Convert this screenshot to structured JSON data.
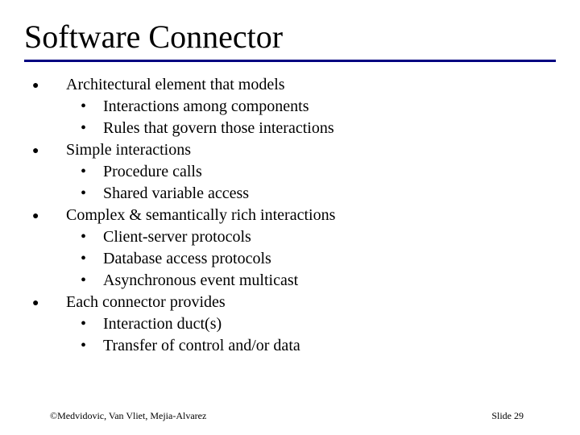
{
  "title": "Software Connector",
  "bullets": [
    {
      "text": "Architectural element that models",
      "sub": [
        "Interactions among components",
        "Rules that govern those interactions"
      ]
    },
    {
      "text": "Simple interactions",
      "sub": [
        "Procedure calls",
        "Shared variable access"
      ]
    },
    {
      "text": "Complex & semantically rich interactions",
      "sub": [
        "Client-server protocols",
        "Database access protocols",
        "Asynchronous event multicast"
      ]
    },
    {
      "text": "Each connector provides",
      "sub": [
        "Interaction duct(s)",
        "Transfer of control and/or data"
      ]
    }
  ],
  "footer": {
    "credit": "©Medvidovic, Van Vliet, Mejia-Alvarez",
    "slide": "Slide 29"
  }
}
